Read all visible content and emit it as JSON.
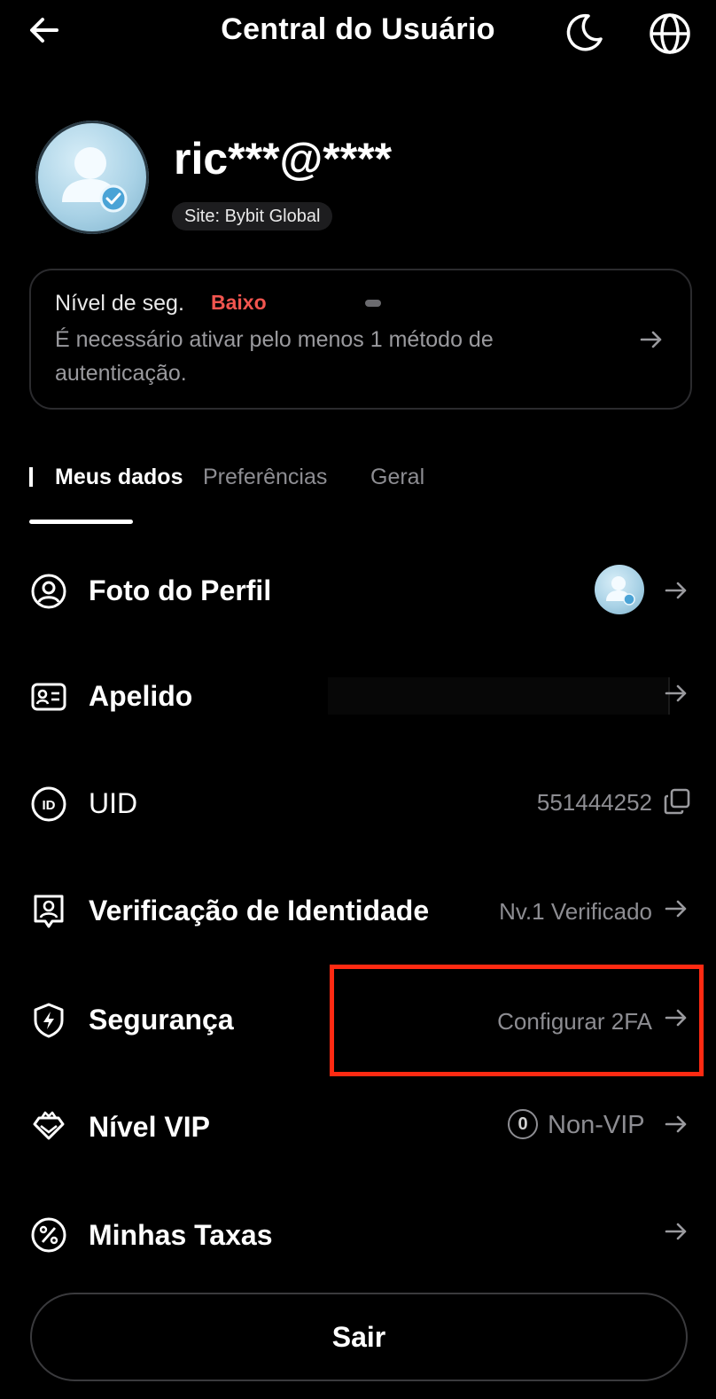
{
  "header": {
    "title": "Central do Usuário",
    "back_icon": "arrow-left-icon",
    "theme_icon": "moon-icon",
    "language_icon": "globe-icon"
  },
  "profile": {
    "username": "ric***@****",
    "site": "Site: Bybit Global"
  },
  "security_card": {
    "label": "Nível de seg.",
    "level": "Baixo",
    "level_color": "#f2554f",
    "description": "É necessário ativar pelo menos 1 método de autenticação."
  },
  "tabs": [
    {
      "label": "Meus dados",
      "active": true
    },
    {
      "label": "Preferências",
      "active": false
    },
    {
      "label": "Geral",
      "active": false
    }
  ],
  "rows": [
    {
      "label": "Foto do Perfil",
      "value": "",
      "icon": "user-circle-icon"
    },
    {
      "label": "Apelido",
      "value": "",
      "icon": "id-card-icon"
    },
    {
      "label": "UID",
      "value": "551444252",
      "icon": "id-badge-icon",
      "action_icon": "copy-icon"
    },
    {
      "label": "Verificação de Identidade",
      "value": "Nv.1 Verificado",
      "icon": "identity-icon"
    },
    {
      "label": "Segurança",
      "value": "Configurar 2FA",
      "icon": "shield-bolt-icon"
    },
    {
      "label": "Nível VIP",
      "value": "Non-VIP",
      "vip_badge": "0",
      "icon": "vip-diamond-icon"
    },
    {
      "label": "Minhas Taxas",
      "value": "",
      "icon": "percent-icon"
    }
  ],
  "logout_label": "Sair",
  "highlight_color": "#ff2a12"
}
